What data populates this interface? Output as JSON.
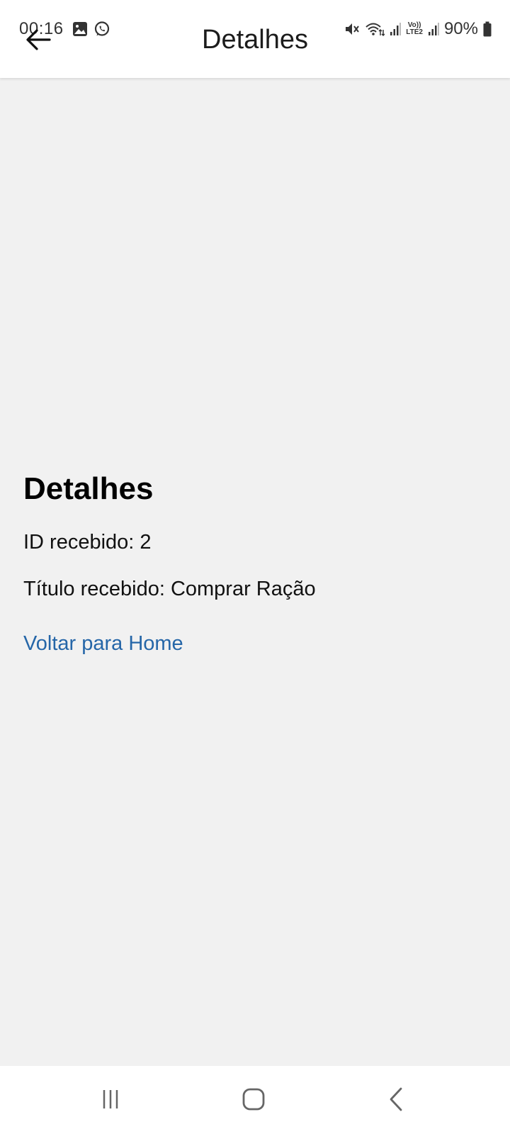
{
  "status_bar": {
    "time": "00:16",
    "battery_percent": "90%",
    "network_label": "LTE2",
    "left_icons": [
      "gallery-icon",
      "whatsapp-icon"
    ],
    "right_icons": [
      "mute-icon",
      "wifi-icon",
      "signal-icon",
      "volte-icon",
      "signal-icon",
      "battery-icon"
    ]
  },
  "header": {
    "title": "Detalhes",
    "back_icon": "arrow-left-icon"
  },
  "content": {
    "heading": "Detalhes",
    "id_line": "ID recebido: 2",
    "title_line": "Título recebido: Comprar Ração",
    "home_link": "Voltar para Home"
  },
  "nav_bar": {
    "icons": [
      "recents-icon",
      "home-icon",
      "back-icon"
    ]
  },
  "colors": {
    "page_background": "#f1f1f1",
    "bar_background": "#ffffff",
    "link": "#2566a8",
    "text": "#111111"
  }
}
